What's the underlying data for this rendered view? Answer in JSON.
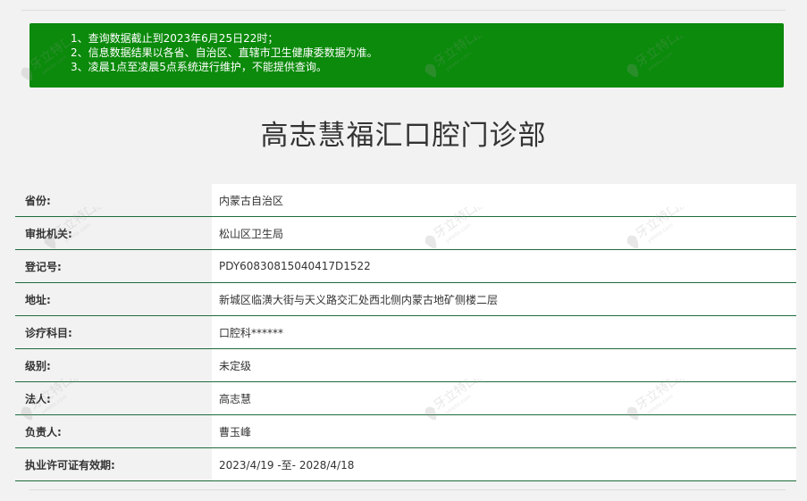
{
  "notice": {
    "lines": [
      "1、查询数据截止到2023年6月25日22时；",
      "2、信息数据结果以各省、自治区、直辖市卫生健康委数据为准。",
      "3、凌晨1点至凌晨5点系统进行维护，不能提供查询。"
    ],
    "background_color": "#0b8a0b"
  },
  "page_title": "高志慧福汇口腔门诊部",
  "details": [
    {
      "label": "省份:",
      "value": "内蒙古自治区"
    },
    {
      "label": "审批机关:",
      "value": "松山区卫生局"
    },
    {
      "label": "登记号:",
      "value": "PDY60830815040417D1522"
    },
    {
      "label": "地址:",
      "value": "新城区临潢大街与天义路交汇处西北侧内蒙古地矿侧楼二层"
    },
    {
      "label": "诊疗科目:",
      "value": "口腔科******"
    },
    {
      "label": "级别:",
      "value": "未定级"
    },
    {
      "label": "法人:",
      "value": "高志慧"
    },
    {
      "label": "负责人:",
      "value": "曹玉峰"
    },
    {
      "label": "执业许可证有效期:",
      "value": "2023/4/19 -至- 2028/4/18"
    }
  ],
  "watermark": {
    "text": "牙立特口腔",
    "subtext": "yelete.com"
  }
}
